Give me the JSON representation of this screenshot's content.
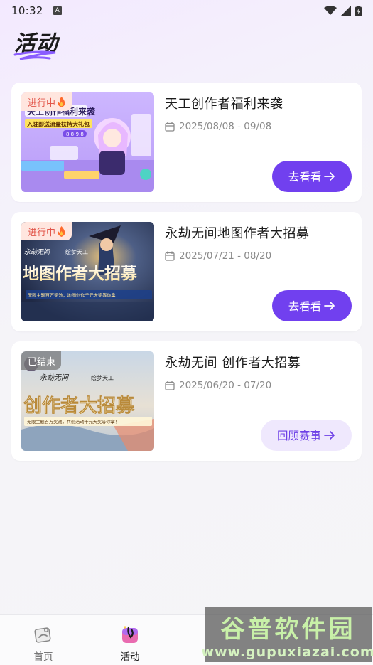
{
  "status_bar": {
    "time": "10:32",
    "badge": "A"
  },
  "header": {
    "title": "活动"
  },
  "activities": [
    {
      "title": "天工创作者福利来袭",
      "date": "2025/08/08 - 09/08",
      "badge": "进行中",
      "button": "去看看",
      "status": "live"
    },
    {
      "title": "永劫无间地图作者大招募",
      "date": "2025/07/21 - 08/20",
      "badge": "进行中",
      "button": "去看看",
      "status": "live"
    },
    {
      "title": "永劫无间 创作者大招募",
      "date": "2025/06/20 - 07/20",
      "badge": "已结束",
      "button": "回顾赛事",
      "status": "ended"
    }
  ],
  "thumbnails": {
    "a1": {
      "headline": "天工创作福利来袭",
      "sub": "入驻即送流量扶持大礼包",
      "dates": "8.8-9.8"
    },
    "a2": {
      "brand": "永劫无间",
      "brand2": "绘梦天工",
      "headline": "地图作者大招募",
      "sub": "无限主题百万奖池，地图创作千元大奖等你拿！"
    },
    "a3": {
      "brand": "永劫无间",
      "brand2": "绘梦天工",
      "headline": "创作者大招募",
      "sub": "无限主题百万奖池，共创活动千元大奖等你拿！"
    }
  },
  "nav": [
    {
      "label": "首页",
      "active": false
    },
    {
      "label": "活动",
      "active": true
    }
  ],
  "watermark": {
    "big": "谷普软件园",
    "small": "www.gupuxiazai.com"
  },
  "colors": {
    "accent": "#7140ef",
    "accent_light": "#efe8fd",
    "live_badge_bg": "#ffe6df",
    "live_badge_text": "#e2564a"
  }
}
